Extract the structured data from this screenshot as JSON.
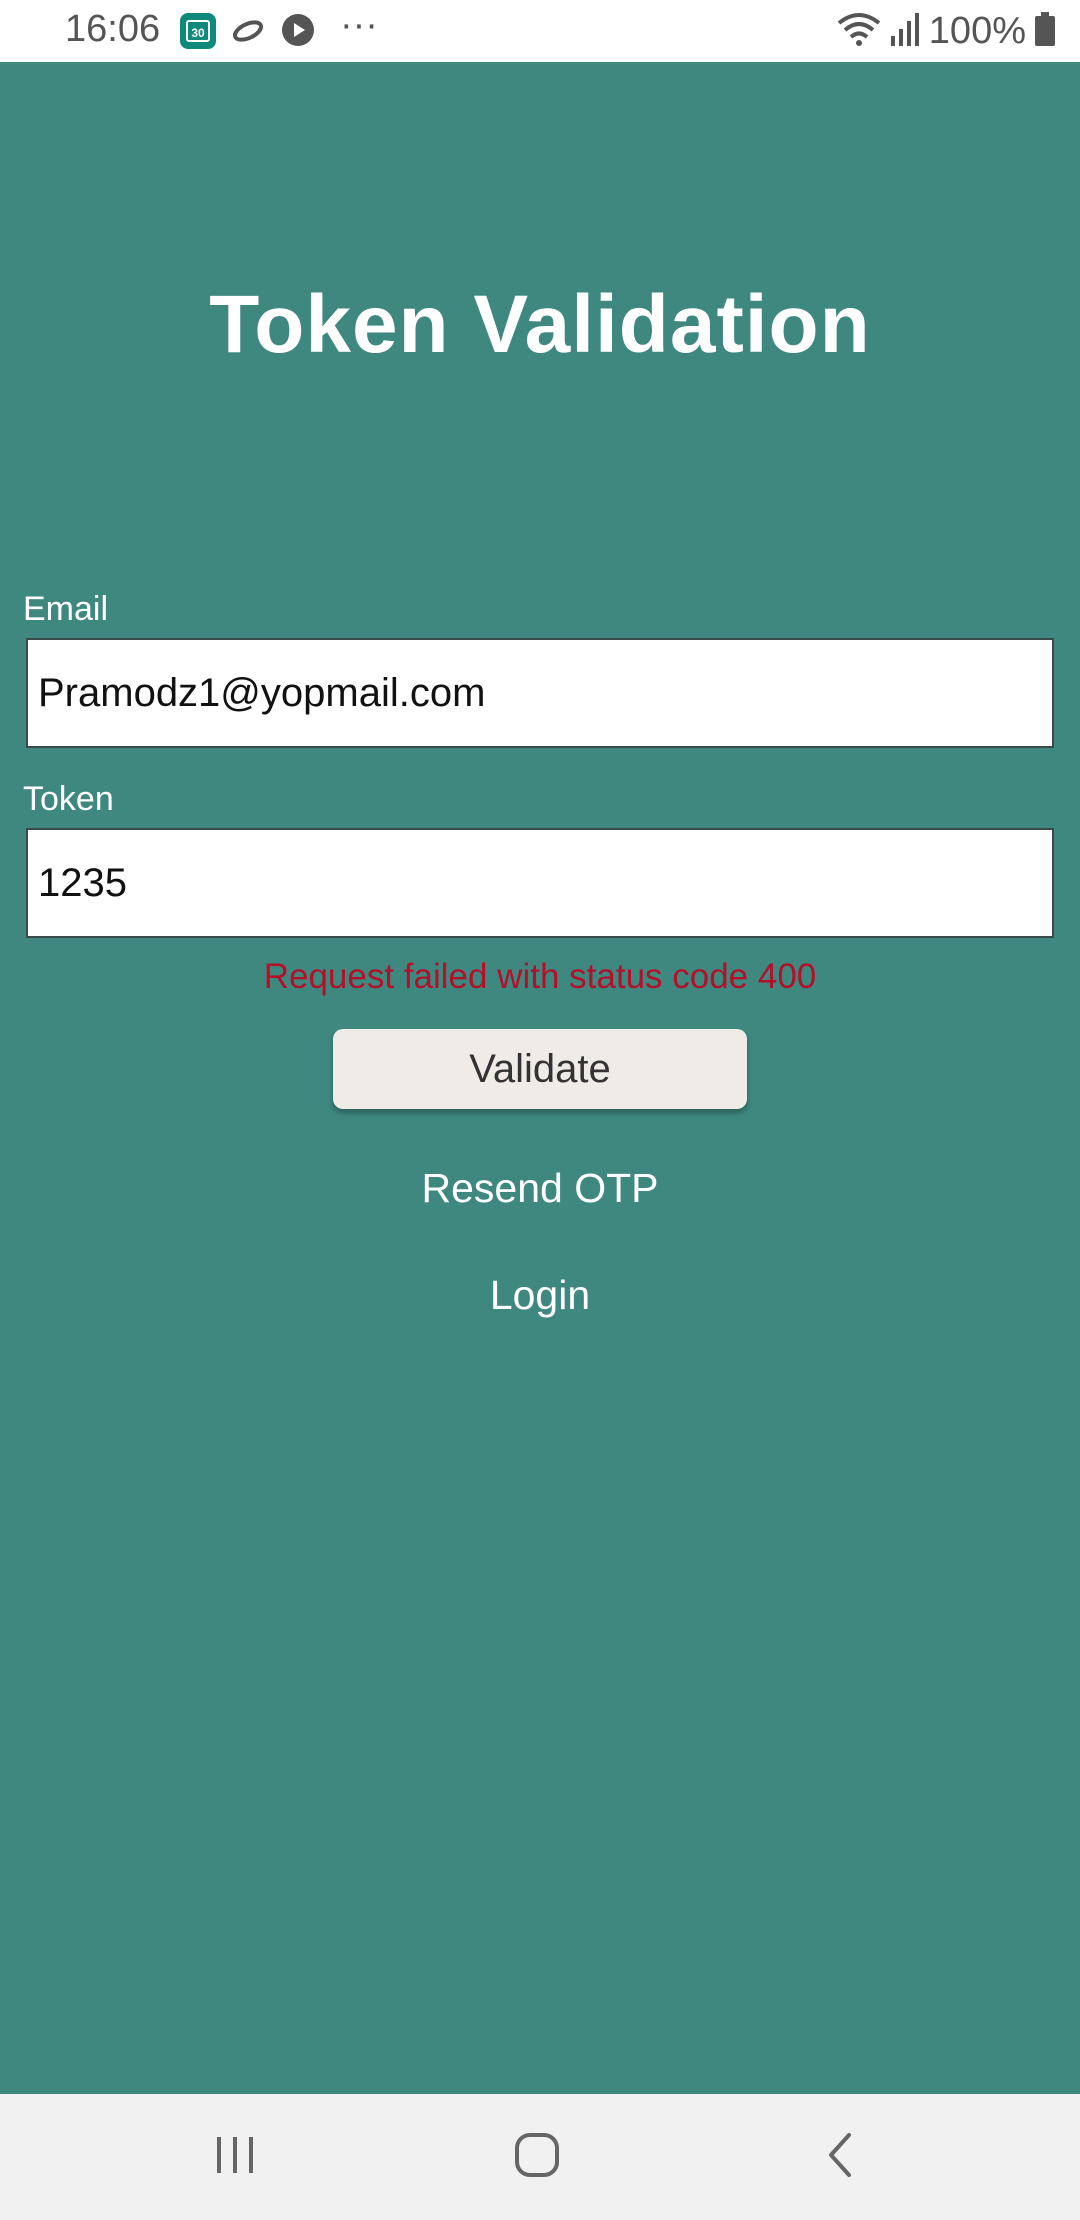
{
  "status_bar": {
    "time": "16:06",
    "calendar_badge": "30",
    "overflow_dots": "···",
    "battery": "100%"
  },
  "page": {
    "title": "Token Validation"
  },
  "form": {
    "email_label": "Email",
    "email_value": "Pramodz1@yopmail.com",
    "token_label": "Token",
    "token_value": "1235",
    "error_message": "Request failed with status code 400",
    "validate_label": "Validate",
    "resend_label": "Resend OTP",
    "login_label": "Login"
  },
  "colors": {
    "background": "#3f8880",
    "error": "#b3102a",
    "button": "#efece8"
  },
  "icons": {
    "status_left": [
      "calendar-icon",
      "link-icon",
      "play-icon"
    ],
    "status_right": [
      "wifi-icon",
      "signal-icon",
      "battery-icon"
    ],
    "nav": [
      "recent-apps-icon",
      "home-icon",
      "back-icon"
    ]
  }
}
